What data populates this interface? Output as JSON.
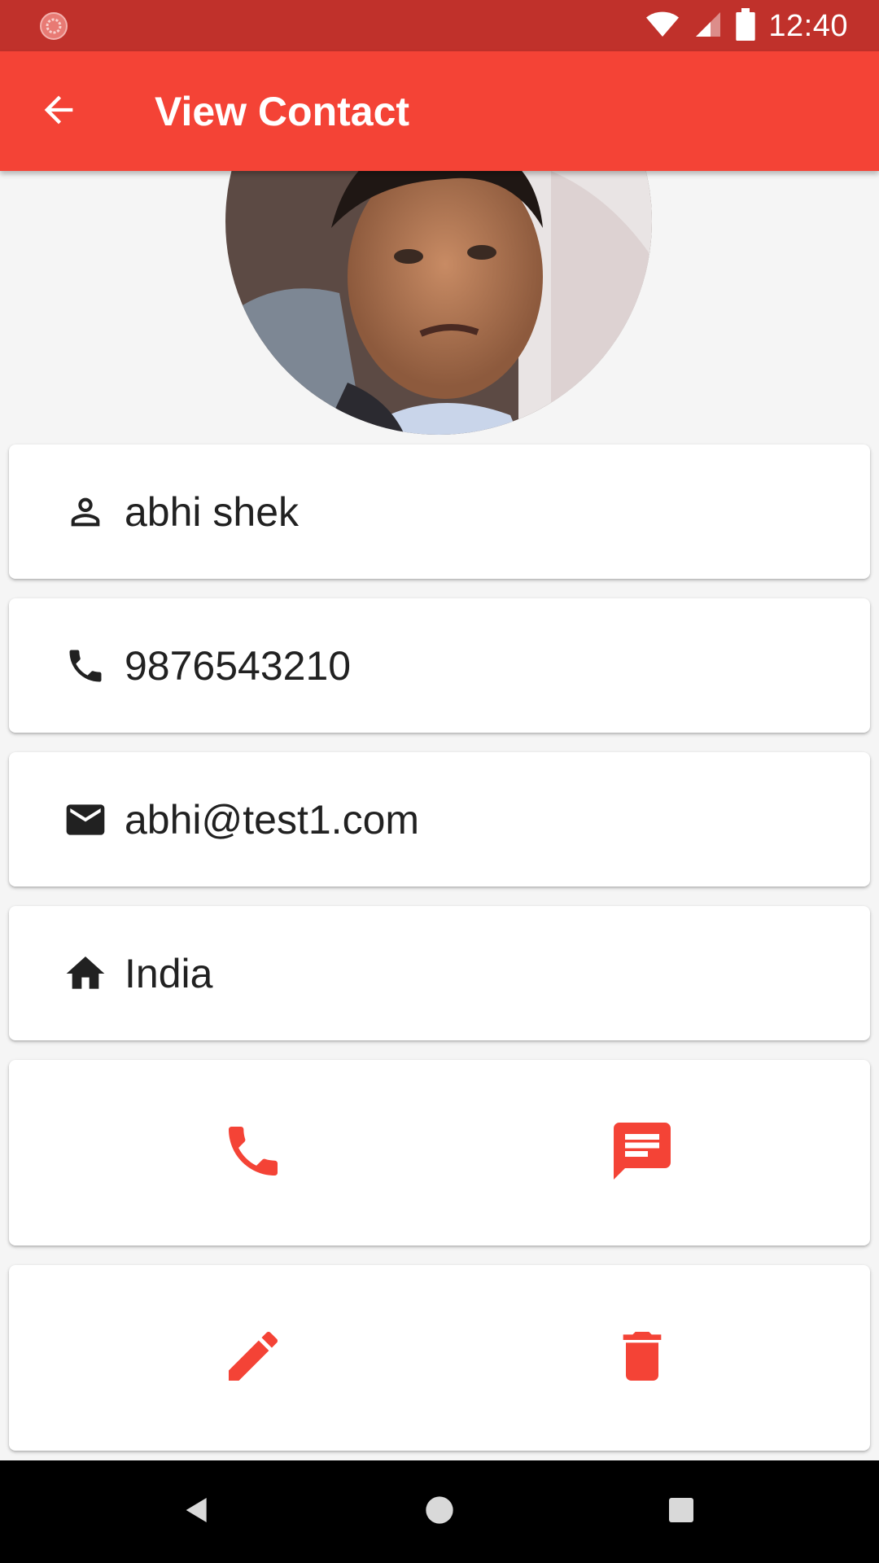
{
  "status_bar": {
    "time": "12:40",
    "icons": [
      "notification-icon",
      "wifi-icon",
      "signal-icon",
      "battery-icon"
    ]
  },
  "app_bar": {
    "title": "View Contact",
    "back_icon": "arrow-back-icon",
    "color": "#f44336"
  },
  "avatar": {
    "icon": "contact-photo"
  },
  "contact": {
    "name": "abhi shek",
    "phone": "9876543210",
    "email": "abhi@test1.com",
    "address": "India"
  },
  "info_icons": {
    "name": "person-icon",
    "phone": "phone-icon",
    "email": "email-icon",
    "address": "home-icon"
  },
  "actions": {
    "row1": [
      "call-icon",
      "message-icon"
    ],
    "row2": [
      "edit-icon",
      "delete-icon"
    ],
    "accent": "#f44336"
  },
  "nav_bar": {
    "icons": [
      "back-triangle-icon",
      "home-circle-icon",
      "recents-square-icon"
    ]
  }
}
